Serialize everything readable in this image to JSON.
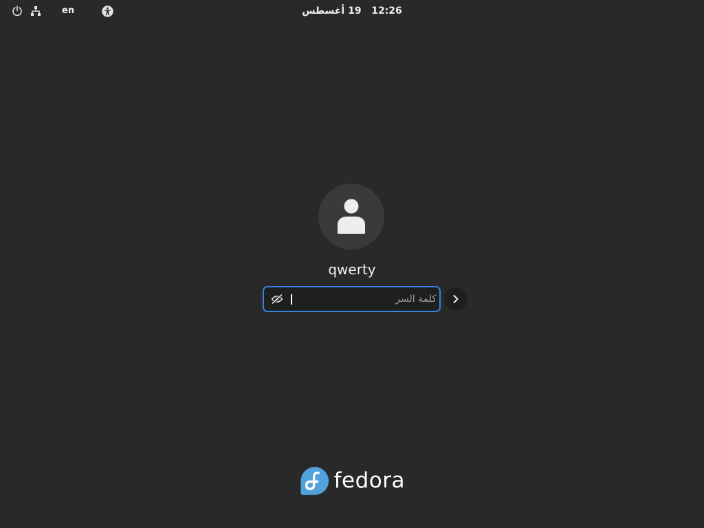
{
  "topbar": {
    "power_icon": "power-icon",
    "network_icon": "network-wired-icon",
    "keyboard_layout": "en",
    "accessibility_icon": "accessibility-icon",
    "clock_date": "19 أغسطس",
    "clock_time": "12:26"
  },
  "login": {
    "avatar_icon": "user-avatar-icon",
    "username": "qwerty",
    "password_placeholder": "كلمة السر",
    "password_value": "",
    "reveal_icon": "eye-hidden-icon",
    "submit_icon": "chevron-right-icon"
  },
  "branding": {
    "logo_text": "fedora",
    "logo_color": "#51a2da"
  },
  "colors": {
    "background": "#292929",
    "focus_accent": "#3584e4"
  }
}
